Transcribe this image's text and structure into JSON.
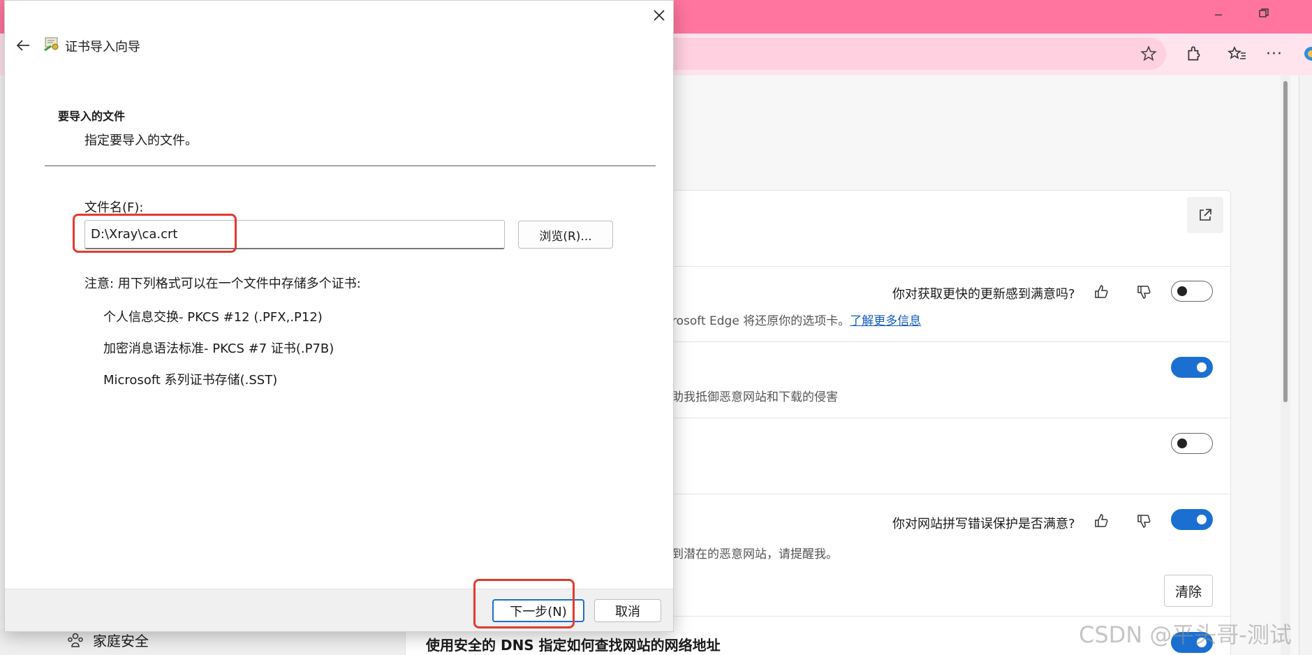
{
  "colors": {
    "titlebar": "#ff75a0",
    "toolbar": "#ffe4ee",
    "accent": "#1a6fd1",
    "annotation": "#e23b2e"
  },
  "edge": {
    "toolbar_icons": [
      "star-icon",
      "extensions-icon",
      "favorites-icon",
      "more-icon"
    ],
    "settings": {
      "row1": {
        "question": "你对获取更快的更新感到满意吗?",
        "description": "rosoft Edge 将还原你的选项卡。",
        "link": "了解更多信息",
        "toggle": "off"
      },
      "row2": {
        "description": "助我抵御恶意网站和下载的侵害",
        "toggle": "on"
      },
      "row3": {
        "toggle": "off"
      },
      "row4": {
        "question": "你对网站拼写错误保护是否满意?",
        "description": "到潜在的恶意网站，请提醒我。",
        "toggle": "on"
      },
      "clear_label": "清除",
      "dns_label": "使用安全的 DNS 指定如何查找网站的网络地址"
    },
    "sidebar": {
      "family_label": "家庭安全"
    },
    "watermark": "CSDN @平头哥-测试"
  },
  "dialog": {
    "title": "证书导入向导",
    "heading": "要导入的文件",
    "subheading": "指定要导入的文件。",
    "file_label": "文件名(F):",
    "file_value": "D:\\Xray\\ca.crt",
    "browse_label": "浏览(R)...",
    "note": "注意: 用下列格式可以在一个文件中存储多个证书:",
    "formats": [
      "个人信息交换- PKCS #12 (.PFX,.P12)",
      "加密消息语法标准- PKCS #7 证书(.P7B)",
      "Microsoft 系列证书存储(.SST)"
    ],
    "next_label": "下一步(N)",
    "cancel_label": "取消"
  }
}
